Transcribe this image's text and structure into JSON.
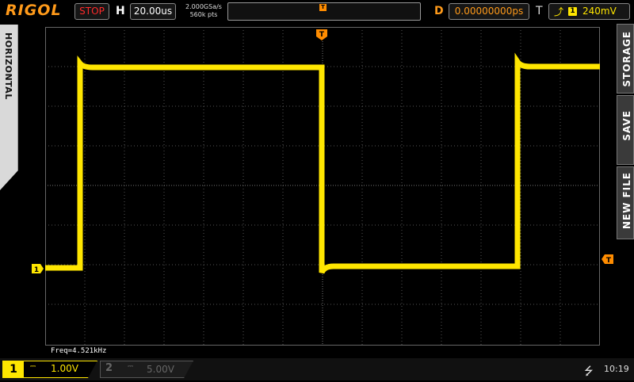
{
  "header": {
    "brand": "RIGOL",
    "run_state": "STOP",
    "horizontal_label": "H",
    "timebase": "20.00us",
    "sample_rate": "2.000GSa/s",
    "memory_depth": "560k pts",
    "delay_label": "D",
    "delay_value": "0.00000000ps",
    "trigger_label": "T",
    "trigger_edge_icon": "rising-edge-icon",
    "trigger_source": "1",
    "trigger_level": "240mV"
  },
  "side_menus": {
    "left": "HORIZONTAL",
    "right_storage": "STORAGE",
    "right_save": "SAVE",
    "right_new_file": "NEW FILE"
  },
  "screen": {
    "markers": {
      "trigger_position": "T",
      "ch1_ground": "1",
      "trigger_level": "T"
    },
    "measurement": "Freq=4.521kHz"
  },
  "channels": [
    {
      "number": "1",
      "coupling_icon": "dc-coupling-icon",
      "scale": "1.00V",
      "active": true,
      "color": "#ffe600"
    },
    {
      "number": "2",
      "coupling_icon": "dc-coupling-icon",
      "scale": "5.00V",
      "active": false,
      "color": "#5a5a5a"
    }
  ],
  "status": {
    "usb_icon": "usb-icon",
    "time": "10:19"
  },
  "colors": {
    "trace": "#ffe600",
    "accent": "#ff8c00",
    "grid": "#5a5a5a"
  }
}
